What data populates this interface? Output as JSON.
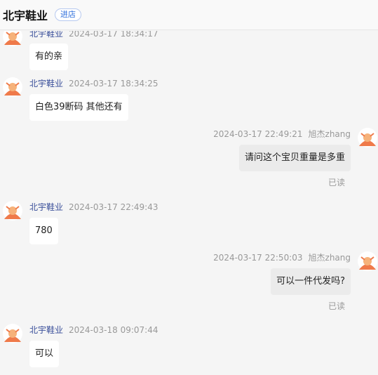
{
  "header": {
    "shop_name": "北宇鞋业",
    "enter_label": "进店"
  },
  "messages": [
    {
      "side": "left",
      "sender": "北宇鞋业",
      "time": "2024-03-17 18:34:17",
      "text": "有的亲"
    },
    {
      "side": "left",
      "sender": "北宇鞋业",
      "time": "2024-03-17 18:34:25",
      "text": "白色39断码 其他还有"
    },
    {
      "side": "right",
      "sender": "旭杰zhang",
      "time": "2024-03-17 22:49:21",
      "text": "请问这个宝贝重量是多重",
      "status": "已读"
    },
    {
      "side": "left",
      "sender": "北宇鞋业",
      "time": "2024-03-17 22:49:43",
      "text": "780"
    },
    {
      "side": "right",
      "sender": "旭杰zhang",
      "time": "2024-03-17 22:50:03",
      "text": "可以一件代发吗?",
      "status": "已读"
    },
    {
      "side": "left",
      "sender": "北宇鞋业",
      "time": "2024-03-18 09:07:44",
      "text": "可以"
    }
  ],
  "colors": {
    "avatar": "#ef7a4a",
    "accent": "#2f6fdc"
  }
}
